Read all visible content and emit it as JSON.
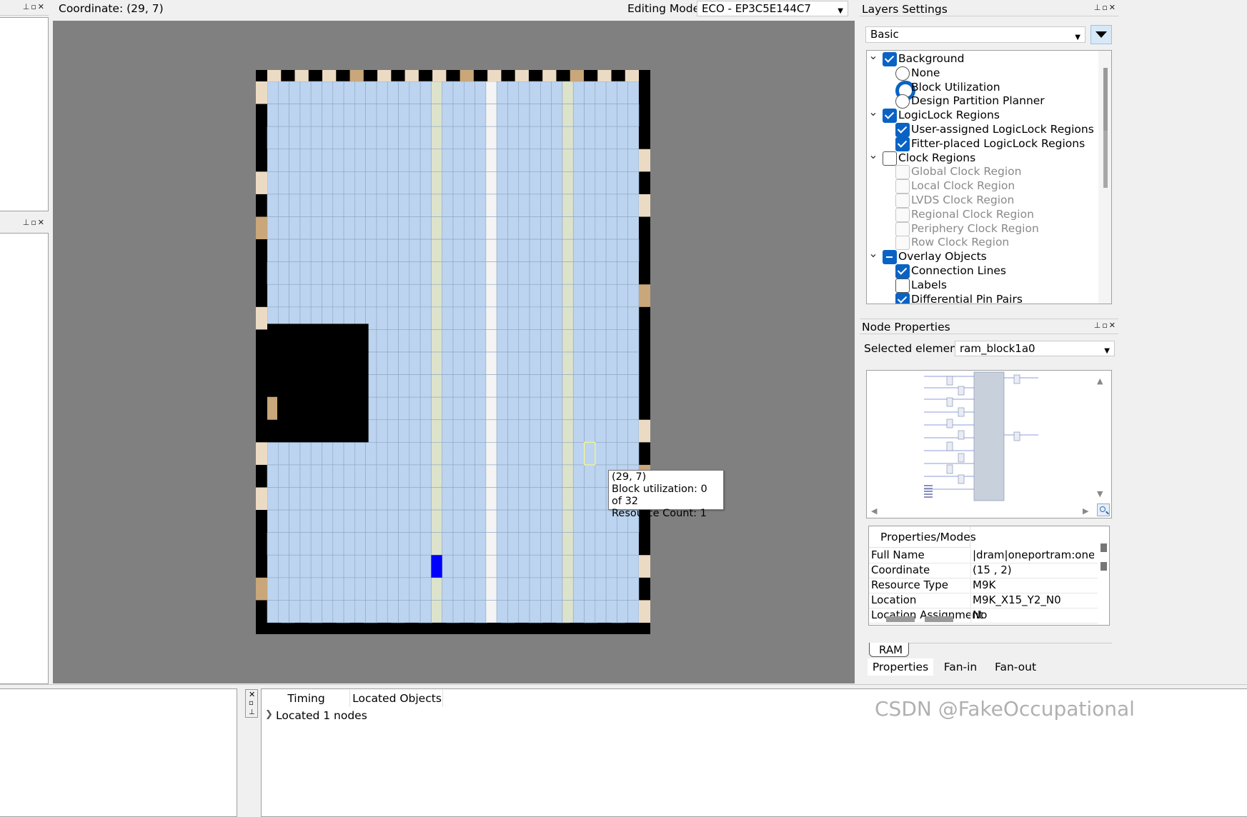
{
  "top_bar": {
    "coordinate_label": "Coordinate: (29, 7)",
    "editing_mode_label": "Editing Mode:",
    "editing_mode_value": "ECO - EP3C5E144C7"
  },
  "layers": {
    "title": "Layers Settings",
    "preset": "Basic",
    "items": [
      {
        "label": "Background",
        "kind": "check",
        "state": "on",
        "level": 0,
        "expand": true
      },
      {
        "label": "None",
        "kind": "radio",
        "state": "off",
        "level": 1
      },
      {
        "label": "Block Utilization",
        "kind": "radio",
        "state": "on",
        "level": 1
      },
      {
        "label": "Design Partition Planner",
        "kind": "radio",
        "state": "off",
        "level": 1
      },
      {
        "label": "LogicLock Regions",
        "kind": "check",
        "state": "on",
        "level": 0,
        "expand": true
      },
      {
        "label": "User-assigned LogicLock Regions",
        "kind": "check",
        "state": "on",
        "level": 1
      },
      {
        "label": "Fitter-placed LogicLock Regions",
        "kind": "check",
        "state": "on",
        "level": 1
      },
      {
        "label": "Clock Regions",
        "kind": "check",
        "state": "off",
        "level": 0,
        "expand": true
      },
      {
        "label": "Global Clock Region",
        "kind": "check",
        "state": "dis",
        "level": 1
      },
      {
        "label": "Local Clock Region",
        "kind": "check",
        "state": "dis",
        "level": 1
      },
      {
        "label": "LVDS Clock Region",
        "kind": "check",
        "state": "dis",
        "level": 1
      },
      {
        "label": "Regional Clock Region",
        "kind": "check",
        "state": "dis",
        "level": 1
      },
      {
        "label": "Periphery Clock Region",
        "kind": "check",
        "state": "dis",
        "level": 1
      },
      {
        "label": "Row Clock Region",
        "kind": "check",
        "state": "dis",
        "level": 1
      },
      {
        "label": "Overlay Objects",
        "kind": "check",
        "state": "partial",
        "level": 0,
        "expand": true
      },
      {
        "label": "Connection Lines",
        "kind": "check",
        "state": "on",
        "level": 1
      },
      {
        "label": "Labels",
        "kind": "check",
        "state": "off",
        "level": 1
      },
      {
        "label": "Differential Pin Pairs",
        "kind": "check",
        "state": "on",
        "level": 1
      }
    ]
  },
  "node_props": {
    "title": "Node Properties",
    "selected_label": "Selected elements:",
    "selected_value": "ram_block1a0",
    "header": "Properties/Modes",
    "rows": [
      {
        "k": "Full Name",
        "v": "|dram|oneportram:onepo"
      },
      {
        "k": "Coordinate",
        "v": "(15 , 2)"
      },
      {
        "k": "Resource Type",
        "v": "M9K"
      },
      {
        "k": "Location",
        "v": "M9K_X15_Y2_N0"
      },
      {
        "k": "Location Assignment",
        "v": "No"
      }
    ],
    "subtab": "RAM",
    "tabs": [
      "Properties",
      "Fan-in",
      "Fan-out"
    ]
  },
  "tooltip": {
    "line1": "(29, 7)",
    "line2": "Block utilization: 0 of 32",
    "line3": "Resource Count: 1"
  },
  "bottom": {
    "tabs": [
      "Timing",
      "Located Objects"
    ],
    "located_text": "Located 1 nodes"
  },
  "watermark": "CSDN @FakeOccupational",
  "colors": {
    "lab": "#bcd4ef",
    "m9k": "#dde3cb",
    "io_light": "#ecdbc4",
    "io_dark": "#c9a77a",
    "selected": "#0000ff",
    "canvas": "#808080"
  },
  "chip_grid": {
    "cols": 34,
    "rows": 24,
    "selected_cell": [
      15,
      2
    ],
    "hover_cell": [
      29,
      7
    ],
    "m9k_columns": [
      15,
      27
    ],
    "gap_column": 20,
    "pll_block": {
      "cols": [
        0,
        8
      ],
      "rows": [
        11,
        15
      ]
    }
  }
}
